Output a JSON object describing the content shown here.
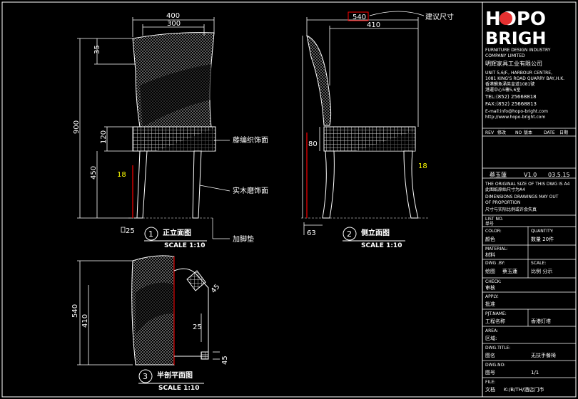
{
  "logo": {
    "line1": "HOPO",
    "line2": "BRIGH"
  },
  "company": {
    "name_en_1": "FURNITURE DESIGN INDUSTRY",
    "name_en_2": "COMPANY LIMITED",
    "name_cn": "明辉家具工业有限公司",
    "addr_1": "UNIT 5,6/F., HARBOUR CENTRE,",
    "addr_2": "1081 KING'S ROAD QUARRY BAY,H.K.",
    "addr_cn_1": "香港鰂魚涌英皇道1081號",
    "addr_cn_2": "港運中心5樓5,6室",
    "tel": "TEL:(852) 25668818",
    "fax": "FAX:(852) 25668813",
    "email": "E-mail:info@hopo-bright.com",
    "web": "http://www.hopo-bright.com"
  },
  "revision": {
    "headers": [
      "REV",
      "修改",
      "NO",
      "版本",
      "DATE",
      "日期"
    ],
    "drawer": "蔡玉蓮",
    "version": "V1.0",
    "date": "03.5.15"
  },
  "notes": {
    "line1": "THE ORIGINAL SIZE OF THIS DWG IS A4",
    "line2": "此图纸原始尺寸为A4",
    "line3": "DIMENSIONS DRAWINGS MAY OUT",
    "line4": "OF PROPORTION",
    "line5": "尺寸与实际比例或许会失真"
  },
  "fields": {
    "list_no_en": "LIST NO.",
    "list_no_cn": "单号",
    "color_en": "COLOR:",
    "color_cn": "颜色",
    "quantity_en": "QUANTITY:",
    "quantity_val": "数量 20件",
    "material_en": "MATERIAL:",
    "material_cn": "材料",
    "dwg_by_en": "DWG .BY:",
    "dwg_by_cn": "绘图",
    "dwg_by_val": "蔡玉蓮",
    "scale_en": "SCALE:",
    "scale_val": "比例 分示",
    "check_en": "CHECK:",
    "check_cn": "审核",
    "apply_en": "APPLY:",
    "apply_cn": "批准",
    "project_en": "PJT.NAME:",
    "project_cn": "工程名称",
    "project_val": "香港灯塔",
    "area_en": "AREA:",
    "area_cn": "区域:",
    "dwg_title_en": "DWG.TITLE:",
    "dwg_title_cn": "图名",
    "dwg_title_val": "无扶手餐椅",
    "dwg_no_en": "DWG.NO:",
    "dwg_no_cn": "图号",
    "dwg_no_val": "1/1",
    "file_en": "FILE:",
    "file_cn": "文档",
    "file_val": "K:/B/TH/酒店门市"
  },
  "views": {
    "front": {
      "num": "1",
      "title": "正立面图",
      "scale": "SCALE 1:10"
    },
    "side": {
      "num": "2",
      "title": "侧立面图",
      "scale": "SCALE 1:10"
    },
    "section": {
      "num": "3",
      "title": "半剖平面图",
      "scale": "SCALE 1:10"
    }
  },
  "dims": {
    "front": {
      "top_width": "400",
      "inner_width": "300",
      "back_height": "35",
      "total_height": "900",
      "seat_band": "120",
      "seat_height": "450",
      "leg": "18",
      "foot": "25"
    },
    "side": {
      "depth_total": "540",
      "depth": "410",
      "seat_band": "80",
      "leg": "18",
      "foot": "63"
    },
    "section": {
      "depth": "540",
      "inner": "410",
      "angle1": "45",
      "gap": "25",
      "corner": "45"
    }
  },
  "callouts": {
    "rattan": "藤编织饰面",
    "wood": "实木磨饰面",
    "pad": "加脚垫",
    "tolerance": "建议尺寸"
  },
  "colors": {
    "background": "#000000",
    "line": "#ffffff",
    "dimension": "#ffff00",
    "accent": "#ff0000",
    "logo_o": "#e53030"
  }
}
